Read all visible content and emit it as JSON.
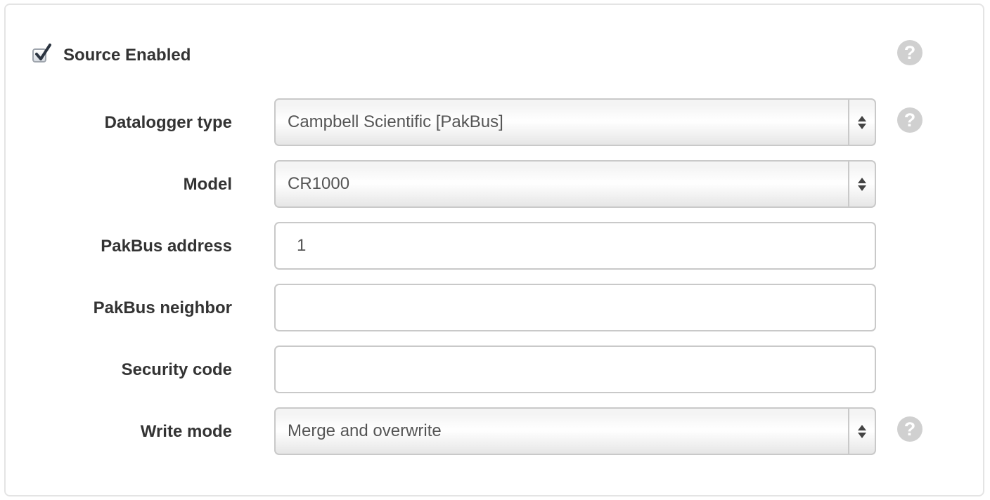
{
  "source_enabled": {
    "label": "Source Enabled",
    "checked": true
  },
  "help_icon_glyph": "?",
  "fields": {
    "datalogger_type": {
      "label": "Datalogger type",
      "value": "Campbell Scientific [PakBus]"
    },
    "model": {
      "label": "Model",
      "value": "CR1000"
    },
    "pakbus_address": {
      "label": "PakBus address",
      "value": "1"
    },
    "pakbus_neighbor": {
      "label": "PakBus neighbor",
      "value": ""
    },
    "security_code": {
      "label": "Security code",
      "value": ""
    },
    "write_mode": {
      "label": "Write mode",
      "value": "Merge and overwrite"
    }
  },
  "colors": {
    "label_text": "#333333",
    "value_text": "#555555",
    "help_icon": "#d0d0d0",
    "border": "#c9c9c9"
  }
}
